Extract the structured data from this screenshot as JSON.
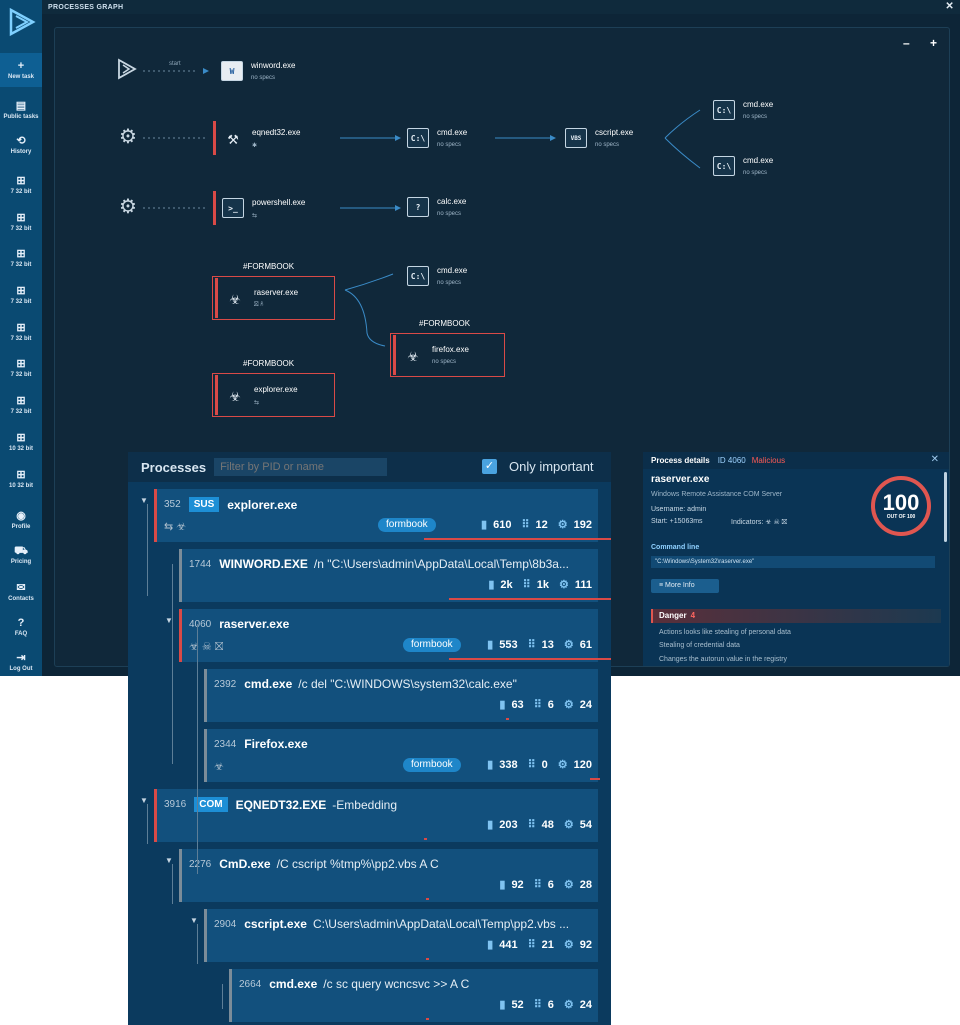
{
  "topbar": {
    "title": "PROCESSES GRAPH",
    "close": "✕"
  },
  "sidebar": {
    "items": [
      {
        "label": "New task",
        "icon": "plus-icon",
        "glyph": "+"
      },
      {
        "label": "Public tasks",
        "icon": "document-icon",
        "glyph": "▤"
      },
      {
        "label": "History",
        "icon": "history-icon",
        "glyph": "⟲"
      },
      {
        "label": "7 32 bit",
        "icon": "windows-icon",
        "glyph": "⊞"
      },
      {
        "label": "7 32 bit",
        "icon": "windows-icon",
        "glyph": "⊞"
      },
      {
        "label": "7 32 bit",
        "icon": "windows-icon",
        "glyph": "⊞"
      },
      {
        "label": "7 32 bit",
        "icon": "windows-icon",
        "glyph": "⊞"
      },
      {
        "label": "7 32 bit",
        "icon": "windows-icon",
        "glyph": "⊞"
      },
      {
        "label": "7 32 bit",
        "icon": "windows-icon",
        "glyph": "⊞"
      },
      {
        "label": "7 32 bit",
        "icon": "windows-icon",
        "glyph": "⊞"
      },
      {
        "label": "10 32 bit",
        "icon": "windows10-icon",
        "glyph": "⊞"
      },
      {
        "label": "10 32 bit",
        "icon": "windows10-icon",
        "glyph": "⊞"
      },
      {
        "label": "Profile",
        "icon": "profile-icon",
        "glyph": "◉"
      },
      {
        "label": "Pricing",
        "icon": "cart-icon",
        "glyph": "⛟"
      },
      {
        "label": "Contacts",
        "icon": "mail-icon",
        "glyph": "✉"
      },
      {
        "label": "FAQ",
        "icon": "help-icon",
        "glyph": "?"
      },
      {
        "label": "Log Out",
        "icon": "logout-icon",
        "glyph": "⇥"
      }
    ]
  },
  "graph": {
    "zoom_out": "–",
    "zoom_in": "+",
    "start_label": "start",
    "nodes": {
      "winword": {
        "name": "winword.exe",
        "sub": "no specs",
        "icon": "W"
      },
      "eqnedt": {
        "name": "eqnedt32.exe",
        "sub": "✱",
        "icon": "⚒"
      },
      "powershell": {
        "name": "powershell.exe",
        "sub": "⇆",
        "icon": ">_"
      },
      "cmd1": {
        "name": "cmd.exe",
        "sub": "no specs",
        "icon": "C:\\"
      },
      "cscript": {
        "name": "cscript.exe",
        "sub": "no specs",
        "icon": "VBS"
      },
      "cmd2": {
        "name": "cmd.exe",
        "sub": "no specs",
        "icon": "C:\\"
      },
      "cmd3": {
        "name": "cmd.exe",
        "sub": "no specs",
        "icon": "C:\\"
      },
      "calc": {
        "name": "calc.exe",
        "sub": "no specs",
        "icon": "?"
      },
      "raserver": {
        "name": "raserver.exe",
        "sub": "⛝ ☠",
        "icon": "☣",
        "tag": "#FORMBOOK"
      },
      "cmd4": {
        "name": "cmd.exe",
        "sub": "no specs",
        "icon": "C:\\"
      },
      "firefox": {
        "name": "firefox.exe",
        "sub": "no specs",
        "icon": "☣",
        "tag": "#FORMBOOK"
      },
      "explorer": {
        "name": "explorer.exe",
        "sub": "⇆",
        "icon": "☣",
        "tag": "#FORMBOOK"
      }
    }
  },
  "processes": {
    "title": "Processes",
    "filter_placeholder": "Filter by PID or name",
    "only_important": "Only important",
    "rows": [
      {
        "pid": "352",
        "badge": "SUS",
        "name": "explorer.exe",
        "args": "",
        "icons": "⇆ ☣",
        "tag": "formbook",
        "files": "610",
        "reg": "12",
        "net": "192"
      },
      {
        "pid": "1744",
        "badge": "",
        "name": "WINWORD.EXE",
        "args": "/n \"C:\\Users\\admin\\AppData\\Local\\Temp\\8b3a...",
        "icons": "",
        "tag": "",
        "files": "2k",
        "reg": "1k",
        "net": "111"
      },
      {
        "pid": "4060",
        "badge": "",
        "name": "raserver.exe",
        "args": "",
        "icons": "☣ ☠ ⛝",
        "tag": "formbook",
        "files": "553",
        "reg": "13",
        "net": "61"
      },
      {
        "pid": "2392",
        "badge": "",
        "name": "cmd.exe",
        "args": "/c del \"C:\\WINDOWS\\system32\\calc.exe\"",
        "icons": "",
        "tag": "",
        "files": "63",
        "reg": "6",
        "net": "24"
      },
      {
        "pid": "2344",
        "badge": "",
        "name": "Firefox.exe",
        "args": "",
        "icons": "☣",
        "tag": "formbook",
        "files": "338",
        "reg": "0",
        "net": "120"
      },
      {
        "pid": "3916",
        "badge": "COM",
        "name": "EQNEDT32.EXE",
        "args": "-Embedding",
        "icons": "",
        "tag": "",
        "files": "203",
        "reg": "48",
        "net": "54"
      },
      {
        "pid": "2276",
        "badge": "",
        "name": "CmD.exe",
        "args": "/C cscript %tmp%\\pp2.vbs A  C",
        "icons": "",
        "tag": "",
        "files": "92",
        "reg": "6",
        "net": "28"
      },
      {
        "pid": "2904",
        "badge": "",
        "name": "cscript.exe",
        "args": "C:\\Users\\admin\\AppData\\Local\\Temp\\pp2.vbs ...",
        "icons": "",
        "tag": "",
        "files": "441",
        "reg": "21",
        "net": "92"
      },
      {
        "pid": "2664",
        "badge": "",
        "name": "cmd.exe",
        "args": "/c sc query wcncsvc >> A  C",
        "icons": "",
        "tag": "",
        "files": "52",
        "reg": "6",
        "net": "24"
      }
    ]
  },
  "details": {
    "title": "Process details",
    "id": "ID 4060",
    "verdict": "Malicious",
    "name": "raserver.exe",
    "description": "Windows Remote Assistance COM Server",
    "username": "Username:  admin",
    "start": "Start:  +15063ms",
    "indicators": "Indicators:  ☣ ☠ ⛝",
    "score": "100",
    "score_sub": "OUT OF 100",
    "cmd_label": "Command line",
    "cmd": "\"C:\\Windows\\System32\\raserver.exe\"",
    "more_info": "≡  More Info",
    "danger_label": "Danger",
    "danger_count": "4",
    "dangers": [
      "Actions looks like stealing of personal data",
      "Stealing of credential data",
      "Changes the autorun value in the registry"
    ]
  }
}
